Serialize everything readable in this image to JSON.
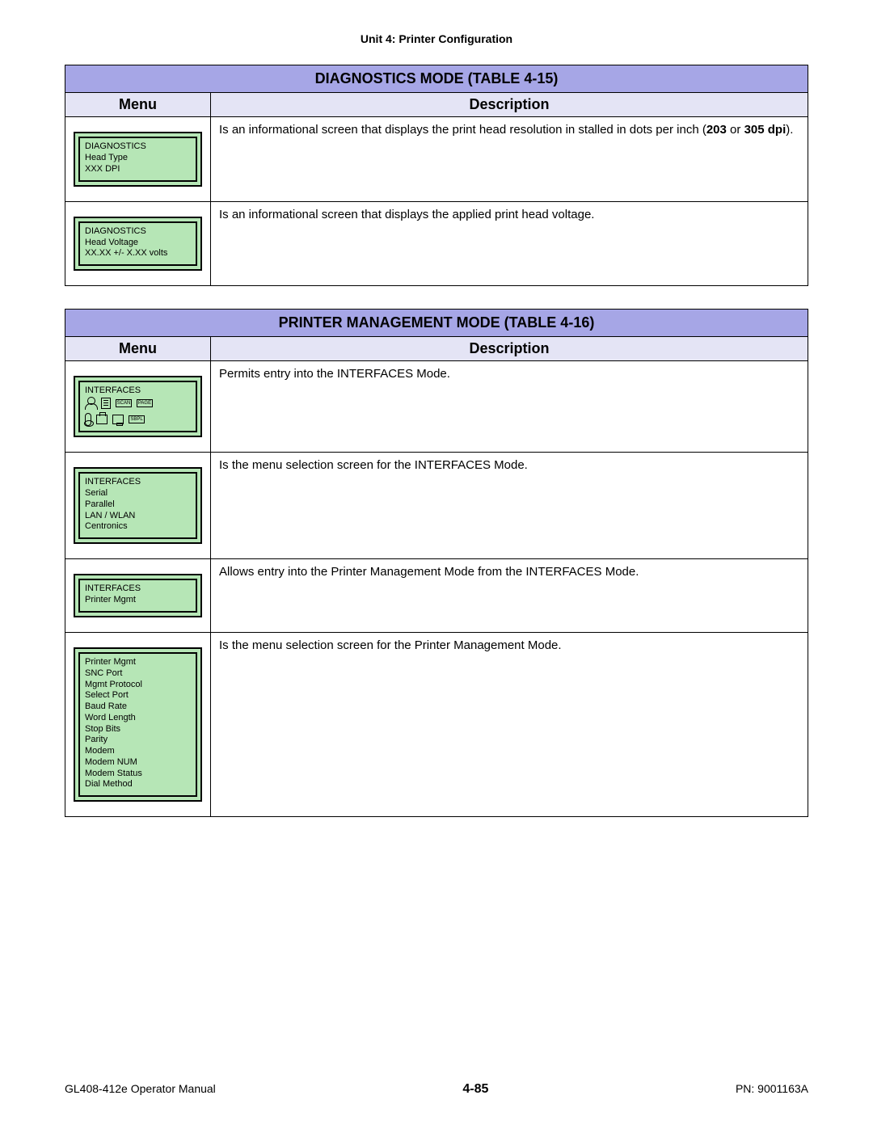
{
  "header": {
    "unit_line": "Unit 4:  Printer Configuration"
  },
  "table1": {
    "title": "DIAGNOSTICS MODE (TABLE 4-15)",
    "col_menu": "Menu",
    "col_desc": "Description",
    "rows": [
      {
        "lcd": {
          "title": "DIAGNOSTICS",
          "lines": [
            "Head Type",
            "XXX  DPI"
          ]
        },
        "desc_prefix": "Is an informational screen that displays the print head resolution in stalled in dots per inch (",
        "desc_bold1": "203",
        "desc_mid": " or ",
        "desc_bold2": "305 dpi",
        "desc_suffix": ")."
      },
      {
        "lcd": {
          "title": "DIAGNOSTICS",
          "lines": [
            "Head Voltage",
            "XX.XX +/- X.XX  volts"
          ]
        },
        "desc": "Is an informational screen that displays the applied print head voltage."
      }
    ]
  },
  "table2": {
    "title": "PRINTER MANAGEMENT MODE (TABLE 4-16)",
    "col_menu": "Menu",
    "col_desc": "Description",
    "rows": [
      {
        "lcd_icons": {
          "title": "INTERFACES",
          "icon_labels": [
            "SCAN",
            "PAGE",
            "SBPL"
          ]
        },
        "desc": "Permits entry into the INTERFACES Mode."
      },
      {
        "lcd": {
          "title": "INTERFACES",
          "lines": [
            "Serial",
            "Parallel",
            "LAN / WLAN",
            "Centronics"
          ]
        },
        "desc": "Is the menu selection screen for the INTERFACES Mode."
      },
      {
        "lcd": {
          "title": "INTERFACES",
          "lines": [
            "Printer Mgmt"
          ]
        },
        "desc": "Allows entry into the Printer Management Mode from the INTERFACES Mode."
      },
      {
        "lcd": {
          "title": "Printer Mgmt",
          "lines": [
            "SNC Port",
            "Mgmt Protocol",
            "Select Port",
            "Baud Rate",
            "Word Length",
            "Stop Bits",
            "Parity",
            "Modem",
            "Modem NUM",
            "Modem Status",
            "Dial Method"
          ]
        },
        "desc": "Is the menu selection screen for the Printer Management Mode."
      }
    ]
  },
  "footer": {
    "left": "GL408-412e Operator Manual",
    "center": "4-85",
    "right": "PN: 9001163A"
  }
}
